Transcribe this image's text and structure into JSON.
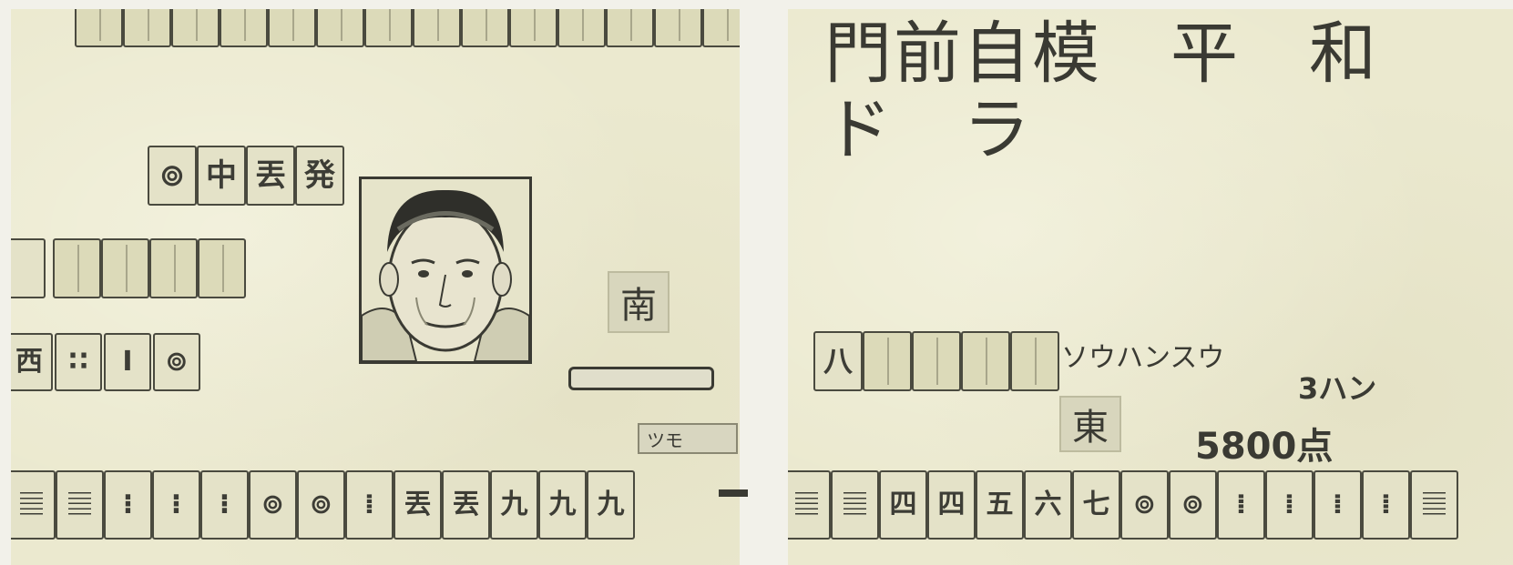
{
  "left_panel": {
    "top_tiles": [
      "",
      "",
      "",
      "",
      "",
      "",
      "",
      "",
      "",
      "",
      "",
      "",
      "",
      ""
    ],
    "opponent_discards": [
      "⊚",
      "中",
      "丟",
      "発"
    ],
    "opponent_meld": [
      "",
      "",
      "",
      ""
    ],
    "left_meld": [
      "西",
      "∷",
      "I",
      "⊚"
    ],
    "wind": "南",
    "tsumo_label": "ツモ",
    "hand": [
      "𝄚",
      "𝄚",
      "⁝",
      "⁝",
      "⁝",
      "⊚",
      "⊚",
      "⁞",
      "丟",
      "丟",
      "九",
      "九",
      "九"
    ]
  },
  "right_panel": {
    "yaku_line1": "門前自模　平　和",
    "yaku_line2": "ド　ラ",
    "meld": [
      "八",
      "",
      "",
      "",
      ""
    ],
    "limit_name": "ソウハンスウ",
    "han": "3ハン",
    "seat_wind": "東",
    "points": "5800点",
    "hand": [
      "𝄚",
      "𝄚",
      "四",
      "四",
      "五",
      "六",
      "七",
      "⊚",
      "⊚",
      "⁞",
      "⁞",
      "⁞",
      "⁞",
      "𝄚"
    ]
  }
}
